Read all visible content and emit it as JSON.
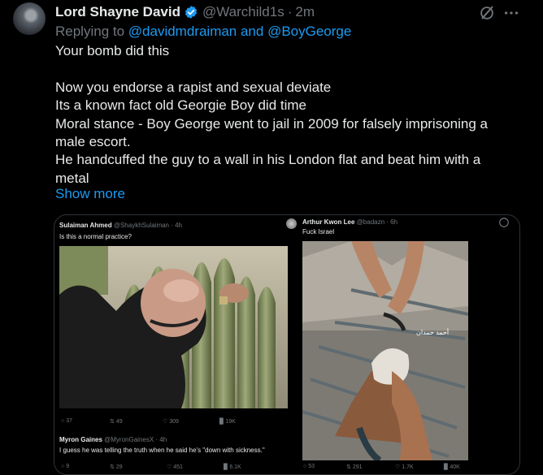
{
  "tweet": {
    "author_name": "Lord Shayne David",
    "handle": "@Warchild1s",
    "separator": "·",
    "time": "2m",
    "replying_prefix": "Replying to ",
    "replying_to": "@davidmdraiman and @BoyGeorge",
    "lines": [
      "Your bomb did this",
      "",
      "Now you endorse a rapist and sexual deviate",
      "Its a known fact old Georgie Boy did time",
      "Moral stance - Boy George went to jail in 2009 for falsely imprisoning a",
      "male escort.",
      "He handcuffed the guy to a wall in his London flat and beat him with a",
      "metal"
    ],
    "show_more": "Show more"
  },
  "embedded": {
    "left": {
      "author": "Sulaiman Ahmed",
      "handle": "@ShaykhSulaiman · 4h",
      "text": "Is this a normal practice?",
      "metrics": [
        "37",
        "49",
        "309",
        "19K"
      ]
    },
    "right": {
      "author": "Arthur Kwon Lee",
      "handle": "@badazn · 6h",
      "text": "Fuck Israel",
      "image_caption": "أحمد حمدان",
      "metrics": [
        "53",
        "291",
        "1.7K",
        "40K"
      ]
    },
    "bottom": {
      "author": "Myron Gaines",
      "handle": "@MyronGainesX · 4h",
      "text": "I guess he was telling the truth when he said he's \"down with sickness.\"",
      "metrics": [
        "9",
        "29",
        "451",
        "6.1K"
      ]
    }
  },
  "colors": {
    "accent": "#1d9bf0",
    "muted": "#71767b",
    "text": "#e7e9ea",
    "background": "#000000"
  }
}
